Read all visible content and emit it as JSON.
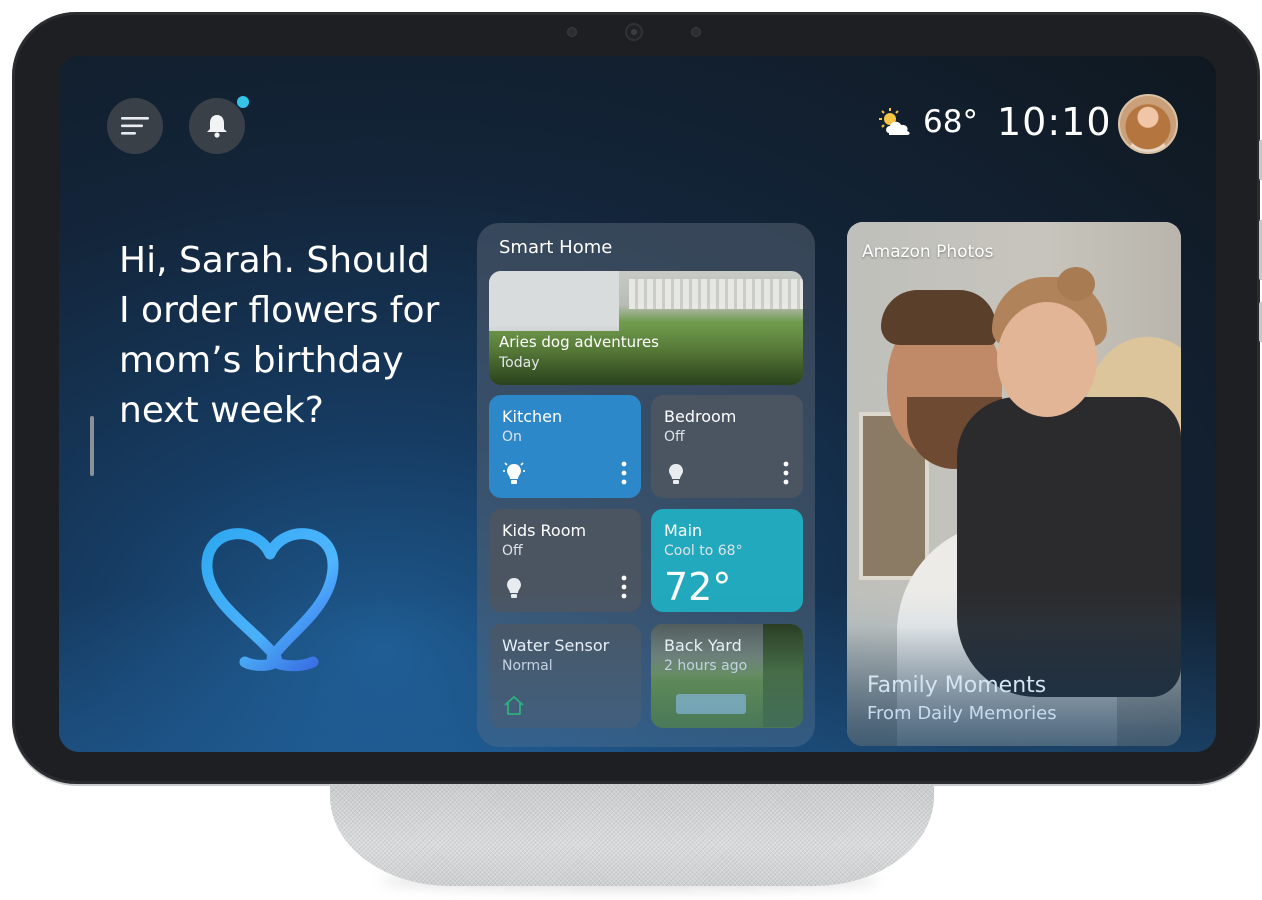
{
  "topbar": {
    "menu_icon": "menu-icon",
    "notification_icon": "bell-icon",
    "notification_dot_color": "#33c4e8",
    "weather_icon": "partly-sunny-icon",
    "temperature": "68°",
    "time": "10:10"
  },
  "greeting": {
    "text": "Hi, Sarah. Should I order flowers for mom’s birthday next week?"
  },
  "smart_home": {
    "title": "Smart Home",
    "camera": {
      "caption": "Aries dog adventures",
      "subcaption": "Today"
    },
    "tiles": [
      {
        "name": "Kitchen",
        "state": "On",
        "icon": "bulb-icon",
        "color": "#2d88c9"
      },
      {
        "name": "Bedroom",
        "state": "Off",
        "icon": "bulb-icon"
      },
      {
        "name": "Kids Room",
        "state": "Off",
        "icon": "bulb-icon"
      },
      {
        "name": "Main",
        "state": "Cool to 68°",
        "value": "72°",
        "color": "#22a9bd"
      },
      {
        "name": "Water Sensor",
        "state": "Normal",
        "icon": "home-icon"
      },
      {
        "name": "Back Yard",
        "state": "2 hours ago"
      }
    ]
  },
  "photos": {
    "label": "Amazon Photos",
    "title": "Family Moments",
    "subtitle": "From Daily Memories"
  }
}
